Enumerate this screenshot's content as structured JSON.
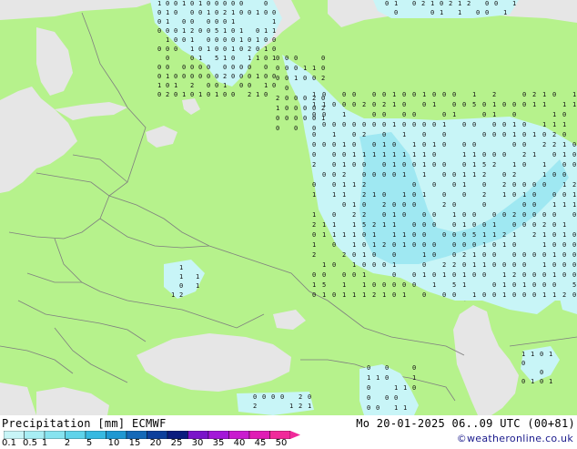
{
  "title": "Precipitation [mm]  ECMWF",
  "datetime": "Mo 20-01-2025 06..09 UTC (00+81)",
  "credit": "©weatheronline.co.uk",
  "legend": {
    "ticks": [
      "0.1",
      "0.5",
      "1",
      "2",
      "5",
      "10",
      "15",
      "20",
      "25",
      "30",
      "35",
      "40",
      "45",
      "50"
    ],
    "colors": [
      "#c8f5f7",
      "#a8eef4",
      "#86e3ef",
      "#5fd3ea",
      "#37b9e1",
      "#1f98d2",
      "#1469b8",
      "#0c3f9c",
      "#0b1c7e",
      "#7a14c9",
      "#a318d8",
      "#c91ccf",
      "#e01cb5",
      "#f02a9a"
    ]
  },
  "colors": {
    "land": "#b6f28c",
    "sea": "#e6e6e6",
    "border": "#7f7f7f",
    "precip_light": "#c8f5f7",
    "precip_medium": "#9fe8f2"
  },
  "grid_labels": [
    "0",
    "1",
    "2",
    "5"
  ]
}
